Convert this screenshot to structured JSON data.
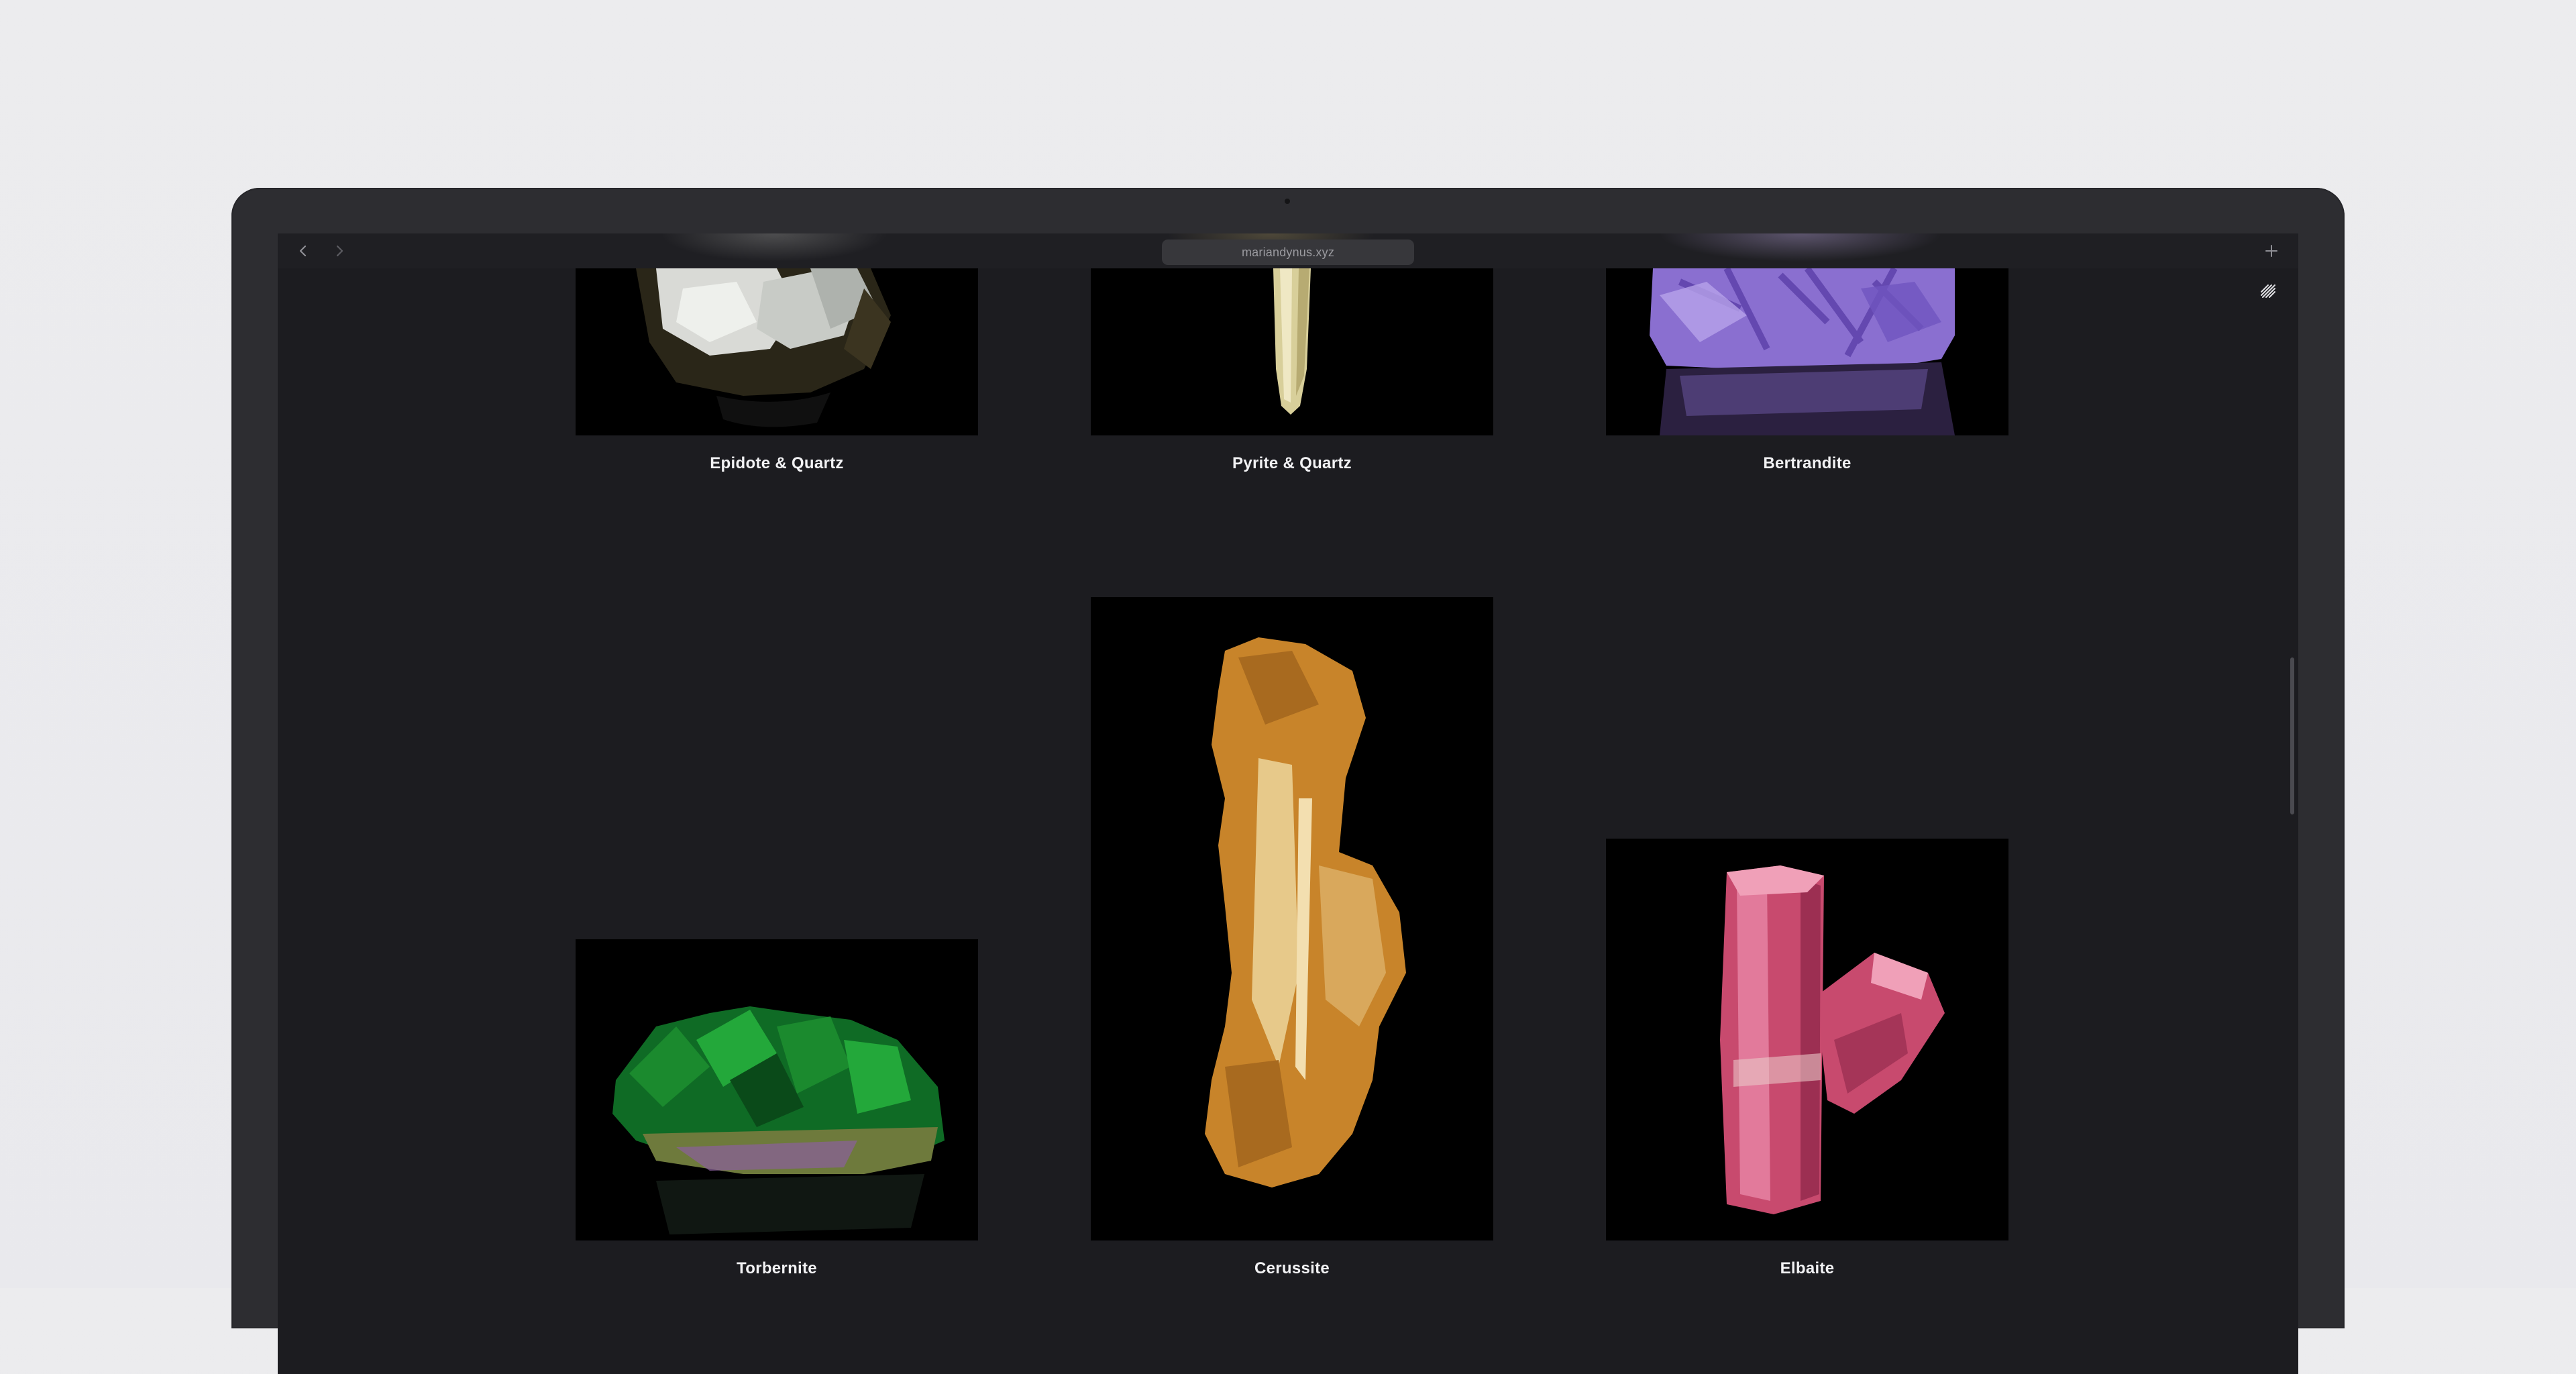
{
  "browser": {
    "address": "mariandynus.xyz",
    "back_icon": "chevron-left-icon",
    "forward_icon": "chevron-right-icon",
    "new_tab_icon": "plus-icon"
  },
  "page": {
    "menu_icon": "striped-menu-icon",
    "minerals": [
      {
        "name": "Epidote & Quartz"
      },
      {
        "name": "Pyrite & Quartz"
      },
      {
        "name": "Bertrandite"
      },
      {
        "name": "Torbernite"
      },
      {
        "name": "Cerussite"
      },
      {
        "name": "Elbaite"
      }
    ]
  },
  "colors": {
    "screen_bg": "#1c1c20",
    "bezel": "#2d2d31",
    "caption_text": "#f2f2f4",
    "torbernite_green": "#1b8a2e",
    "cerussite_amber": "#c8842a",
    "elbaite_pink": "#d24f78",
    "bertrandite_violet": "#8a6fd0"
  }
}
